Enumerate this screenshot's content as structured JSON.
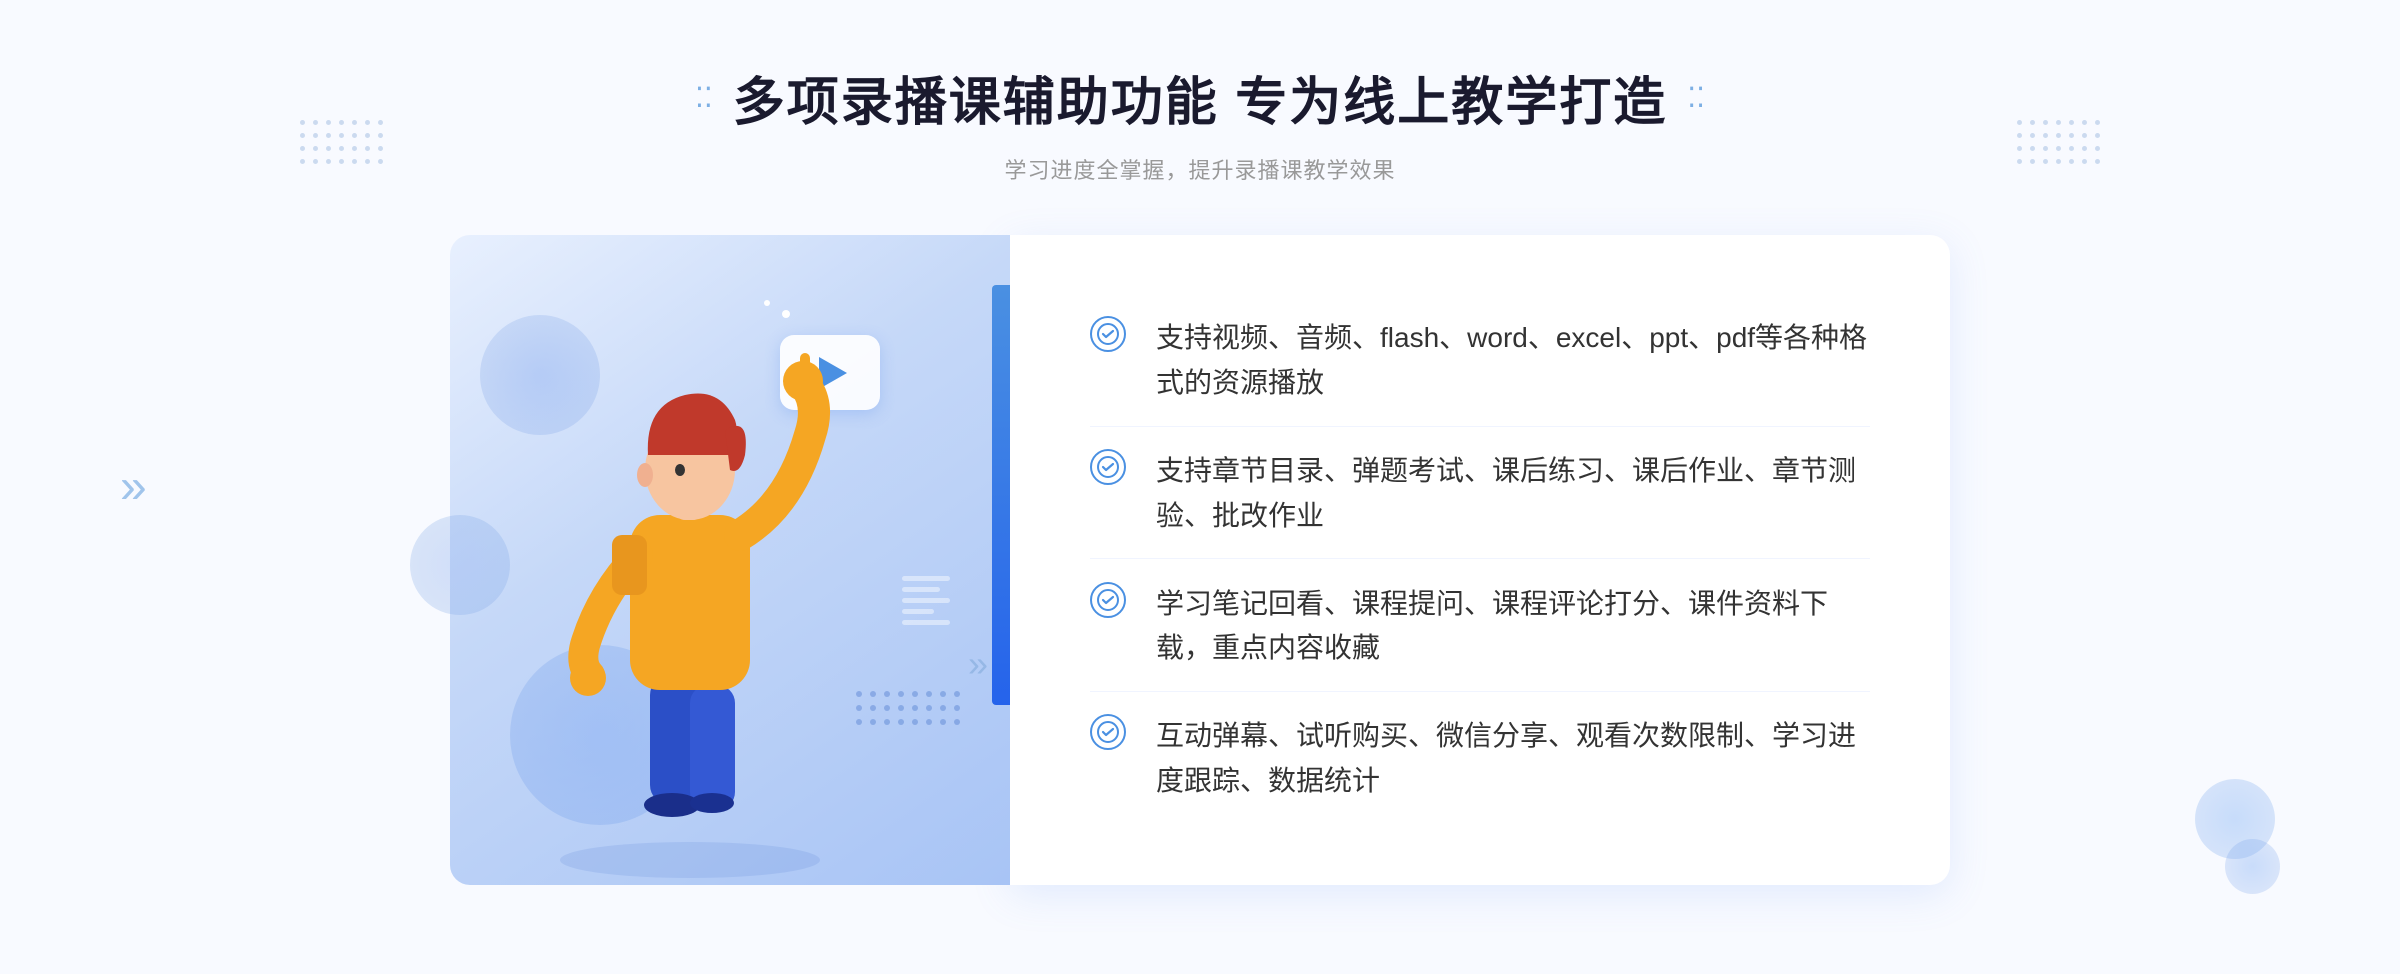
{
  "header": {
    "decoration_left": "⁚⁚",
    "decoration_right": "⁚⁚",
    "main_title": "多项录播课辅助功能 专为线上教学打造",
    "sub_title": "学习进度全掌握，提升录播课教学效果"
  },
  "features": [
    {
      "id": 1,
      "text": "支持视频、音频、flash、word、excel、ppt、pdf等各种格式的资源播放"
    },
    {
      "id": 2,
      "text": "支持章节目录、弹题考试、课后练习、课后作业、章节测验、批改作业"
    },
    {
      "id": 3,
      "text": "学习笔记回看、课程提问、课程评论打分、课件资料下载，重点内容收藏"
    },
    {
      "id": 4,
      "text": "互动弹幕、试听购买、微信分享、观看次数限制、学习进度跟踪、数据统计"
    }
  ],
  "check_icon": "✓",
  "illustration": {
    "play_icon": "▶"
  }
}
